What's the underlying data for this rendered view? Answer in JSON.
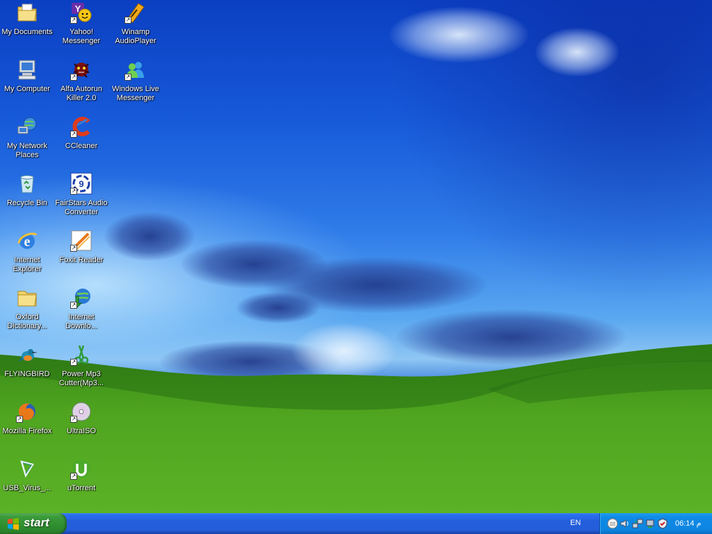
{
  "desktop_icons": [
    {
      "key": "my-documents",
      "label": "My Documents",
      "shortcut": false
    },
    {
      "key": "my-computer",
      "label": "My Computer",
      "shortcut": false
    },
    {
      "key": "my-network-places",
      "label": "My Network Places",
      "shortcut": false
    },
    {
      "key": "recycle-bin",
      "label": "Recycle Bin",
      "shortcut": false
    },
    {
      "key": "internet-explorer",
      "label": "Internet Explorer",
      "shortcut": false
    },
    {
      "key": "oxford-dictionary",
      "label": "Oxford Dictionary...",
      "shortcut": false
    },
    {
      "key": "flyingbird",
      "label": "FLYINGBIRD",
      "shortcut": false
    },
    {
      "key": "mozilla-firefox",
      "label": "Mozilla Firefox",
      "shortcut": true
    },
    {
      "key": "usb-virus",
      "label": "USB_Virus_...",
      "shortcut": false
    },
    {
      "key": "yahoo-messenger",
      "label": "Yahoo! Messenger",
      "shortcut": true
    },
    {
      "key": "alfa-autorun-killer",
      "label": "Alfa Autorun Killer 2.0",
      "shortcut": true
    },
    {
      "key": "ccleaner",
      "label": "CCleaner",
      "shortcut": true
    },
    {
      "key": "fairstars-audio-converter",
      "label": "FairStars Audio Converter",
      "shortcut": true
    },
    {
      "key": "foxit-reader",
      "label": "Foxit Reader",
      "shortcut": true
    },
    {
      "key": "internet-download-manager",
      "label": "Internet Downlo...",
      "shortcut": true
    },
    {
      "key": "power-mp3-cutter",
      "label": "Power Mp3 Cutter(Mp3...",
      "shortcut": true
    },
    {
      "key": "ultraiso",
      "label": "UltraISO",
      "shortcut": true
    },
    {
      "key": "utorrent",
      "label": "uTorrent",
      "shortcut": true
    },
    {
      "key": "winamp",
      "label": "Winamp AudioPlayer",
      "shortcut": true
    },
    {
      "key": "windows-live-messenger",
      "label": "Windows Live Messenger",
      "shortcut": true
    }
  ],
  "taskbar": {
    "start_label": "start",
    "language": "EN",
    "clock": "06:14 م",
    "tray_icons": [
      "messenger-tray-icon",
      "speaker-tray-icon",
      "network-tray-icon",
      "safely-remove-tray-icon",
      "security-tray-icon"
    ]
  },
  "colors": {
    "taskbar_blue": "#245edb",
    "start_green": "#3c9c3c",
    "tray_blue": "#0f8ae6",
    "grass_green": "#4fa51f"
  }
}
